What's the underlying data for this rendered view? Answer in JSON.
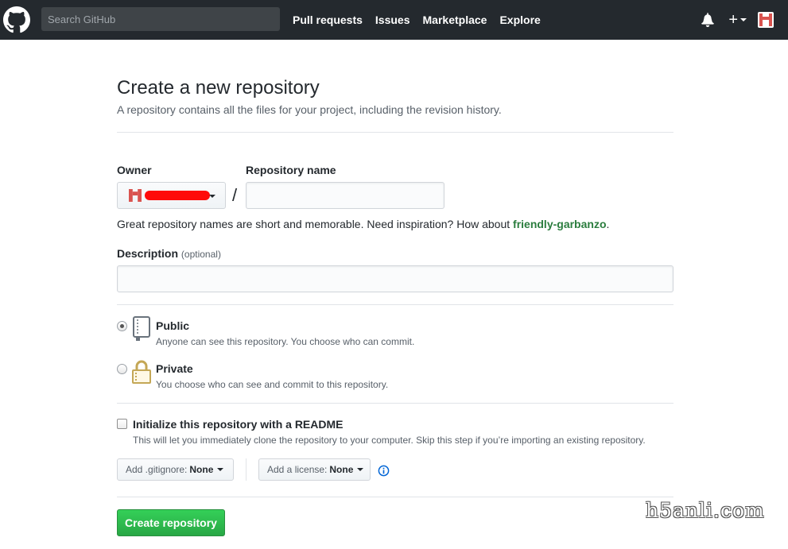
{
  "header": {
    "search_placeholder": "Search GitHub",
    "nav": [
      "Pull requests",
      "Issues",
      "Marketplace",
      "Explore"
    ],
    "icons": [
      "github-logo-icon",
      "bell-icon",
      "plus-icon",
      "avatar-icon"
    ]
  },
  "page": {
    "title": "Create a new repository",
    "subtitle": "A repository contains all the files for your project, including the revision history."
  },
  "form": {
    "owner_label": "Owner",
    "repo_name_label": "Repository name",
    "slash": "/",
    "hint_prefix": "Great repository names are short and memorable. Need inspiration? How about ",
    "hint_suggestion": "friendly-garbanzo",
    "hint_suffix": ".",
    "description_label": "Description",
    "description_optional": "(optional)",
    "visibility": {
      "selected": "public",
      "public_title": "Public",
      "public_note": "Anyone can see this repository. You choose who can commit.",
      "private_title": "Private",
      "private_note": "You choose who can see and commit to this repository."
    },
    "init": {
      "checked": false,
      "label": "Initialize this repository with a README",
      "note": "This will let you immediately clone the repository to your computer. Skip this step if you’re importing an existing repository."
    },
    "gitignore_label": "Add .gitignore:",
    "gitignore_value": "None",
    "license_label": "Add a license:",
    "license_value": "None",
    "submit_label": "Create repository"
  },
  "colors": {
    "header_bg": "#24292e",
    "primary_green": "#28a745",
    "suggestion_green": "#2b7d3e",
    "redaction": "#ff0a0a"
  },
  "watermark": "h5anli.com"
}
